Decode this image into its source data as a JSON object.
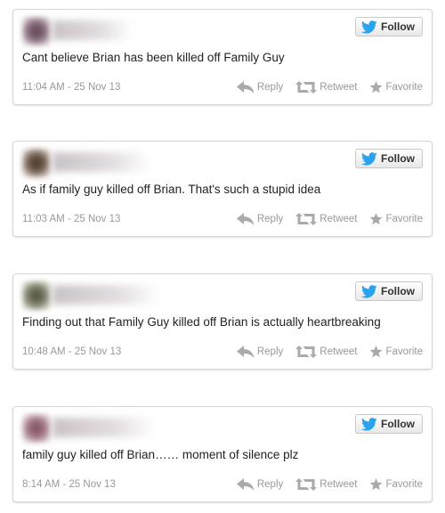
{
  "follow_label": "Follow",
  "actions": {
    "reply": "Reply",
    "retweet": "Retweet",
    "favorite": "Favorite"
  },
  "colors": {
    "twitter_blue": "#2aa3ef",
    "muted_text": "#999999"
  },
  "icons": {
    "bird": "twitter-bird-icon",
    "reply": "reply-arrow-icon",
    "retweet": "retweet-icon",
    "favorite": "star-icon"
  },
  "tweets": [
    {
      "text": "Cant believe Brian has been killed off Family Guy",
      "timestamp": "11:04 AM - 25 Nov 13"
    },
    {
      "text": "As if family guy killed off Brian. That's such a stupid idea",
      "timestamp": "11:03 AM - 25 Nov 13"
    },
    {
      "text": "Finding out that Family Guy killed off Brian is actually heartbreaking",
      "timestamp": "10:48 AM - 25 Nov 13"
    },
    {
      "text": "family guy killed off Brian…… moment of silence plz",
      "timestamp": "8:14 AM - 25 Nov 13"
    }
  ]
}
